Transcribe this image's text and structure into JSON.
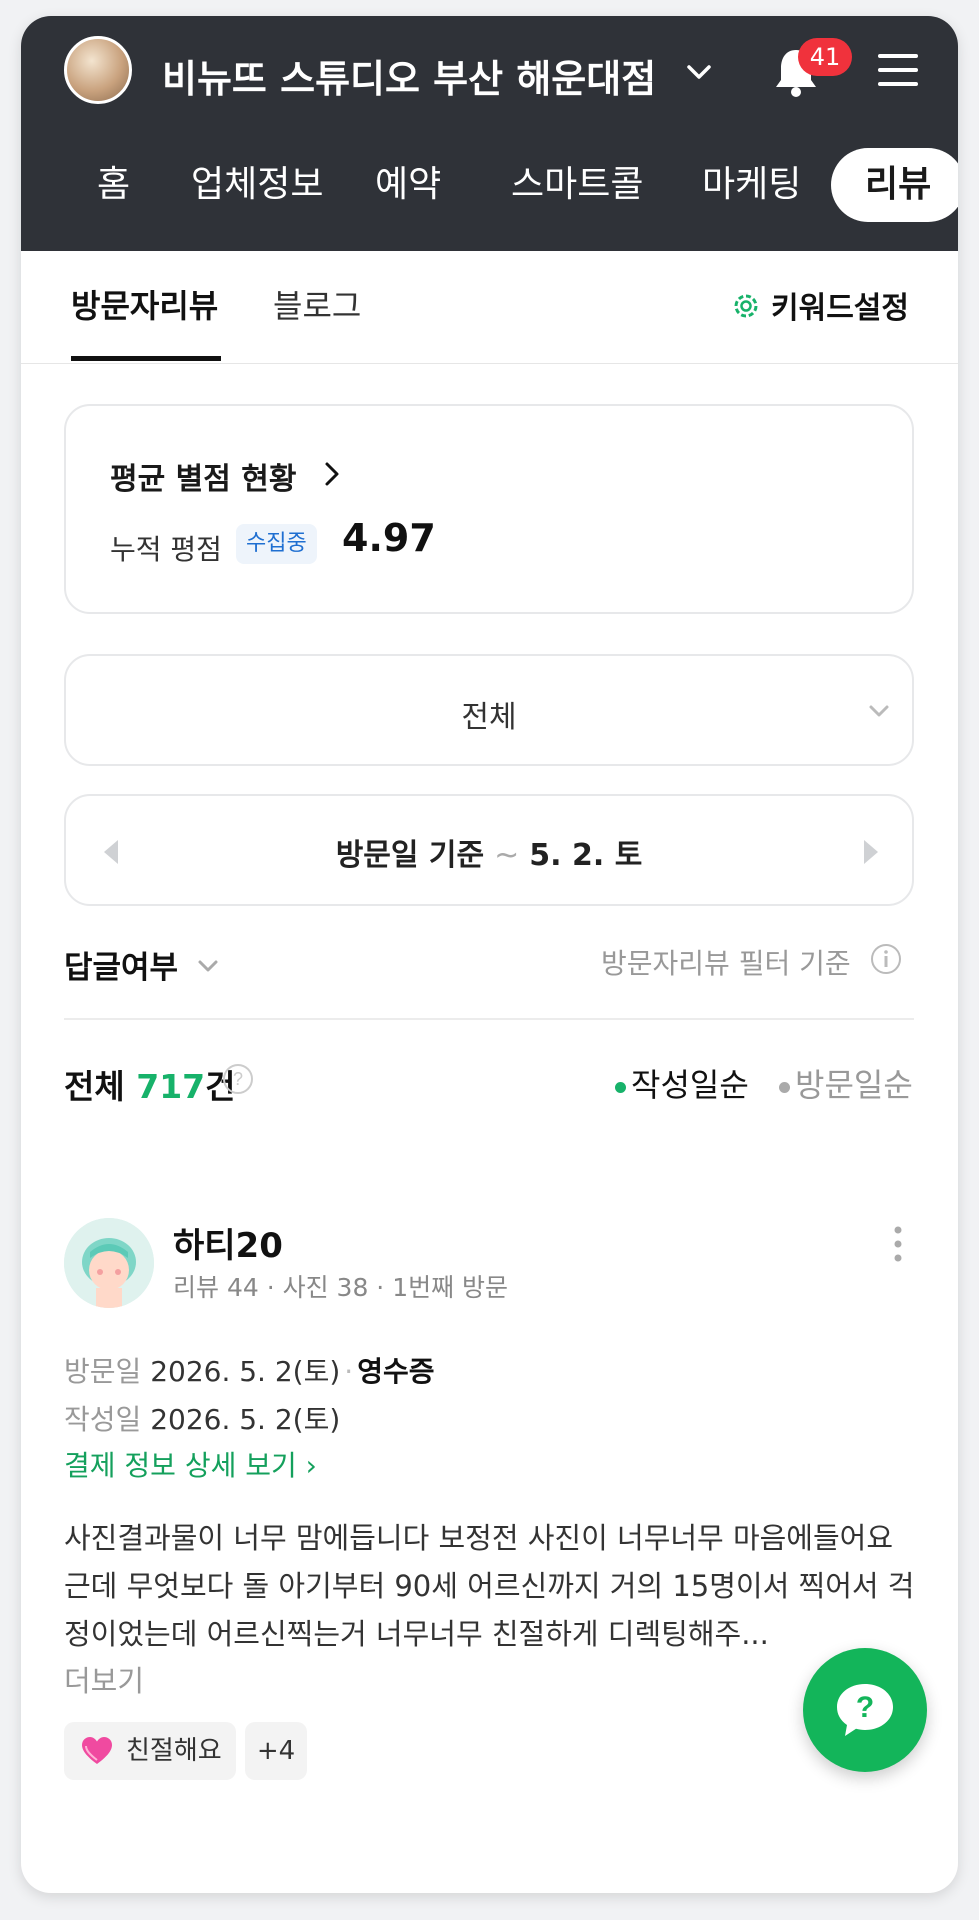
{
  "header": {
    "store_name": "비뉴뜨 스튜디오 부산 해운대점",
    "notification_count": "41",
    "nav_tabs": [
      "홈",
      "업체정보",
      "예약",
      "스마트콜",
      "마케팅",
      "리뷰"
    ],
    "active_nav": "리뷰"
  },
  "subtabs": {
    "items": [
      "방문자리뷰",
      "블로그"
    ],
    "active": "방문자리뷰",
    "keyword_settings": "키워드설정"
  },
  "rating": {
    "title": "평균 별점 현황",
    "label": "누적 평점",
    "status": "수집중",
    "value": "4.97"
  },
  "filter": {
    "selected": "전체"
  },
  "date_range": {
    "label": "방문일 기준",
    "separator": "~",
    "date": "5. 2. 토"
  },
  "reply_filter": {
    "label": "답글여부",
    "basis_label": "방문자리뷰 필터 기준"
  },
  "summary": {
    "prefix": "전체",
    "count": "717",
    "suffix": "건",
    "sort_options": [
      "작성일순",
      "방문일순"
    ],
    "active_sort": "작성일순"
  },
  "review": {
    "nickname": "하티20",
    "stats": "리뷰 44 · 사진 38 · 1번째 방문",
    "visit_label": "방문일",
    "visit_date": "2026. 5. 2(토)",
    "verification": "영수증",
    "written_label": "작성일",
    "written_date": "2026. 5. 2(토)",
    "payment_link": "결제 정보 상세 보기 ›",
    "text": "사진결과물이 너무 맘에듭니다 보정전 사진이 너무너무 마음에들어요 근데 무엇보다 돌 아기부터 90세 어르신까지 거의 15명이서 찍어서 걱정이었는데 어르신찍는거 너무너무 친절하게 디렉팅해주...",
    "more": "더보기",
    "tag": "친절해요",
    "tag_more": "+4"
  },
  "colors": {
    "header_bg": "#2f3238",
    "accent_green": "#17b26a",
    "badge_red": "#f0323c",
    "fab_green": "#13b55a"
  }
}
